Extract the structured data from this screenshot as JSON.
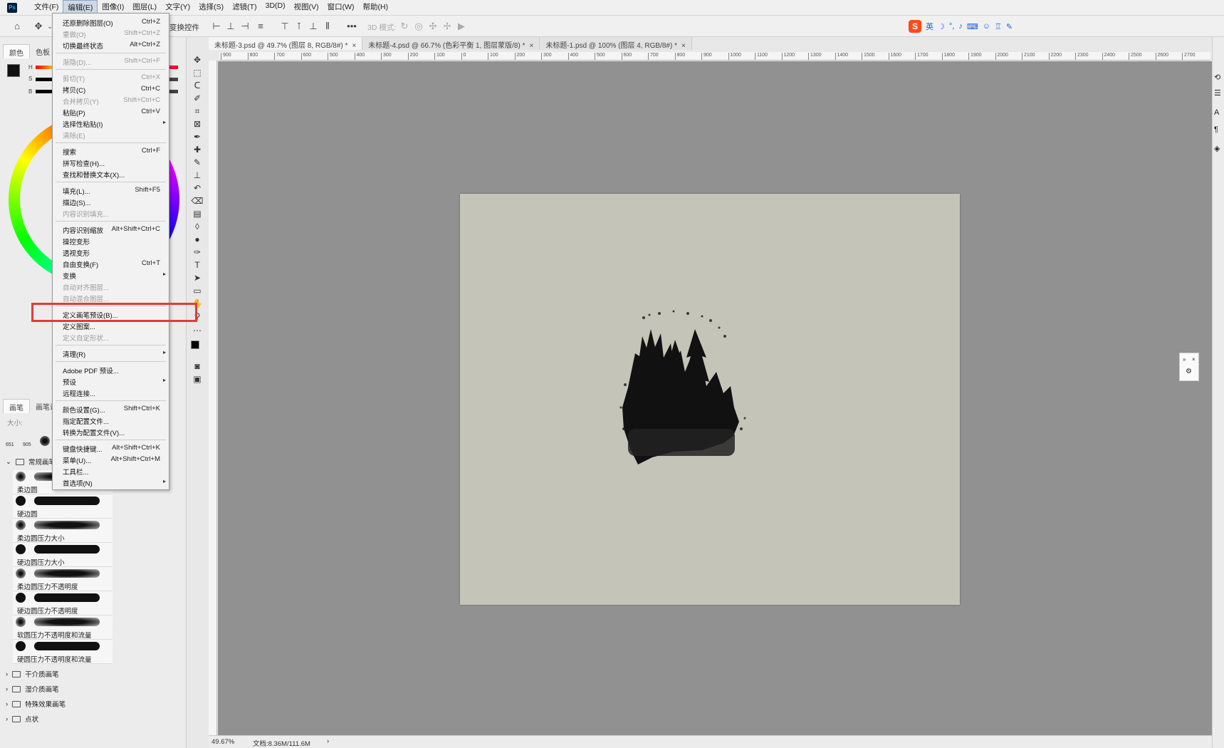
{
  "app": {
    "logo": "Ps"
  },
  "menubar": [
    "文件(F)",
    "编辑(E)",
    "图像(I)",
    "图层(L)",
    "文字(Y)",
    "选择(S)",
    "滤镜(T)",
    "3D(D)",
    "视图(V)",
    "窗口(W)",
    "帮助(H)"
  ],
  "optbar": {
    "transform_controls": "变换控件",
    "mode_3d": "3D 模式:"
  },
  "ime": {
    "lang": "英"
  },
  "left_panel": {
    "top_tabs": [
      "颜色",
      "色板"
    ],
    "hsb": [
      "H",
      "S",
      "B"
    ],
    "brush_tabs": [
      "画笔",
      "画笔设置"
    ],
    "size_label": "大小:",
    "brush_sizes": [
      "651",
      "905"
    ],
    "group_default": "常规画笔",
    "brushes": [
      {
        "label": "柔边圆",
        "soft": true
      },
      {
        "label": "硬边圆",
        "soft": false
      },
      {
        "label": "柔边圆压力大小",
        "soft": true
      },
      {
        "label": "硬边圆压力大小",
        "soft": false
      },
      {
        "label": "柔边圆压力不透明度",
        "soft": true
      },
      {
        "label": "硬边圆压力不透明度",
        "soft": false
      },
      {
        "label": "软圆压力不透明度和流量",
        "soft": true
      },
      {
        "label": "硬圆压力不透明度和流量",
        "soft": false
      }
    ],
    "folders": [
      "干介质画笔",
      "湿介质画笔",
      "特殊效果画笔",
      "点状"
    ]
  },
  "doc_tabs": [
    {
      "label": "未标题-3.psd @ 49.7% (图层 8, RGB/8#) *",
      "close": "×"
    },
    {
      "label": "未标题-4.psd @ 66.7% (色彩平衡 1, 图层蒙版/8) *",
      "close": "×"
    },
    {
      "label": "未标题-1.psd @ 100% (图层 4, RGB/8#) *",
      "close": "×"
    }
  ],
  "ruler_marks": [
    "900",
    "800",
    "700",
    "600",
    "500",
    "400",
    "300",
    "200",
    "100",
    "0",
    "100",
    "200",
    "300",
    "400",
    "500",
    "600",
    "700",
    "800",
    "900",
    "1000",
    "1100",
    "1200",
    "1300",
    "1400",
    "1500",
    "1600",
    "1700",
    "1800",
    "1900",
    "2000",
    "2100",
    "2200",
    "2300",
    "2400",
    "2500",
    "2600",
    "2700"
  ],
  "status": {
    "zoom": "49.67%",
    "doc": "文档:8.36M/111.6M",
    "arrow": "›"
  },
  "edit_menu": {
    "items": [
      {
        "label": "还原删除图层(O)",
        "shortcut": "Ctrl+Z",
        "disabled": false
      },
      {
        "label": "重做(O)",
        "shortcut": "Shift+Ctrl+Z",
        "disabled": true
      },
      {
        "label": "切换最终状态",
        "shortcut": "Alt+Ctrl+Z",
        "disabled": false
      },
      {
        "sep": true
      },
      {
        "label": "渐隐(D)...",
        "shortcut": "Shift+Ctrl+F",
        "disabled": true
      },
      {
        "sep": true
      },
      {
        "label": "剪切(T)",
        "shortcut": "Ctrl+X",
        "disabled": true
      },
      {
        "label": "拷贝(C)",
        "shortcut": "Ctrl+C",
        "disabled": false
      },
      {
        "label": "合并拷贝(Y)",
        "shortcut": "Shift+Ctrl+C",
        "disabled": true
      },
      {
        "label": "粘贴(P)",
        "shortcut": "Ctrl+V",
        "disabled": false
      },
      {
        "label": "选择性粘贴(I)",
        "shortcut": "",
        "disabled": false,
        "submenu": true
      },
      {
        "label": "清除(E)",
        "shortcut": "",
        "disabled": true
      },
      {
        "sep": true
      },
      {
        "label": "搜索",
        "shortcut": "Ctrl+F",
        "disabled": false
      },
      {
        "label": "拼写检查(H)...",
        "shortcut": "",
        "disabled": false
      },
      {
        "label": "查找和替换文本(X)...",
        "shortcut": "",
        "disabled": false
      },
      {
        "sep": true
      },
      {
        "label": "填充(L)...",
        "shortcut": "Shift+F5",
        "disabled": false
      },
      {
        "label": "描边(S)...",
        "shortcut": "",
        "disabled": false
      },
      {
        "label": "内容识别填充...",
        "shortcut": "",
        "disabled": true
      },
      {
        "sep": true
      },
      {
        "label": "内容识别缩放",
        "shortcut": "Alt+Shift+Ctrl+C",
        "disabled": false
      },
      {
        "label": "操控变形",
        "shortcut": "",
        "disabled": false
      },
      {
        "label": "透视变形",
        "shortcut": "",
        "disabled": false
      },
      {
        "label": "自由变换(F)",
        "shortcut": "Ctrl+T",
        "disabled": false
      },
      {
        "label": "变换",
        "shortcut": "",
        "disabled": false,
        "submenu": true
      },
      {
        "label": "自动对齐图层...",
        "shortcut": "",
        "disabled": true
      },
      {
        "label": "自动混合图层...",
        "shortcut": "",
        "disabled": true
      },
      {
        "sep": true
      },
      {
        "label": "定义画笔预设(B)...",
        "shortcut": "",
        "disabled": false,
        "highlighted": true
      },
      {
        "label": "定义图案...",
        "shortcut": "",
        "disabled": false
      },
      {
        "label": "定义自定形状...",
        "shortcut": "",
        "disabled": true
      },
      {
        "sep": true
      },
      {
        "label": "清理(R)",
        "shortcut": "",
        "disabled": false,
        "submenu": true
      },
      {
        "sep": true
      },
      {
        "label": "Adobe PDF 预设...",
        "shortcut": "",
        "disabled": false
      },
      {
        "label": "预设",
        "shortcut": "",
        "disabled": false,
        "submenu": true
      },
      {
        "label": "远程连接...",
        "shortcut": "",
        "disabled": false
      },
      {
        "sep": true
      },
      {
        "label": "颜色设置(G)...",
        "shortcut": "Shift+Ctrl+K",
        "disabled": false
      },
      {
        "label": "指定配置文件...",
        "shortcut": "",
        "disabled": false
      },
      {
        "label": "转换为配置文件(V)...",
        "shortcut": "",
        "disabled": false
      },
      {
        "sep": true
      },
      {
        "label": "键盘快捷键...",
        "shortcut": "Alt+Shift+Ctrl+K",
        "disabled": false
      },
      {
        "label": "菜单(U)...",
        "shortcut": "Alt+Shift+Ctrl+M",
        "disabled": false
      },
      {
        "label": "工具栏...",
        "shortcut": "",
        "disabled": false
      },
      {
        "label": "首选项(N)",
        "shortcut": "",
        "disabled": false,
        "submenu": true
      }
    ],
    "submenu_arrow": "▸"
  },
  "colors": {
    "canvas_bg": "#919191",
    "document_bg": "#c4c5b8",
    "highlight": "#e23b3b"
  }
}
